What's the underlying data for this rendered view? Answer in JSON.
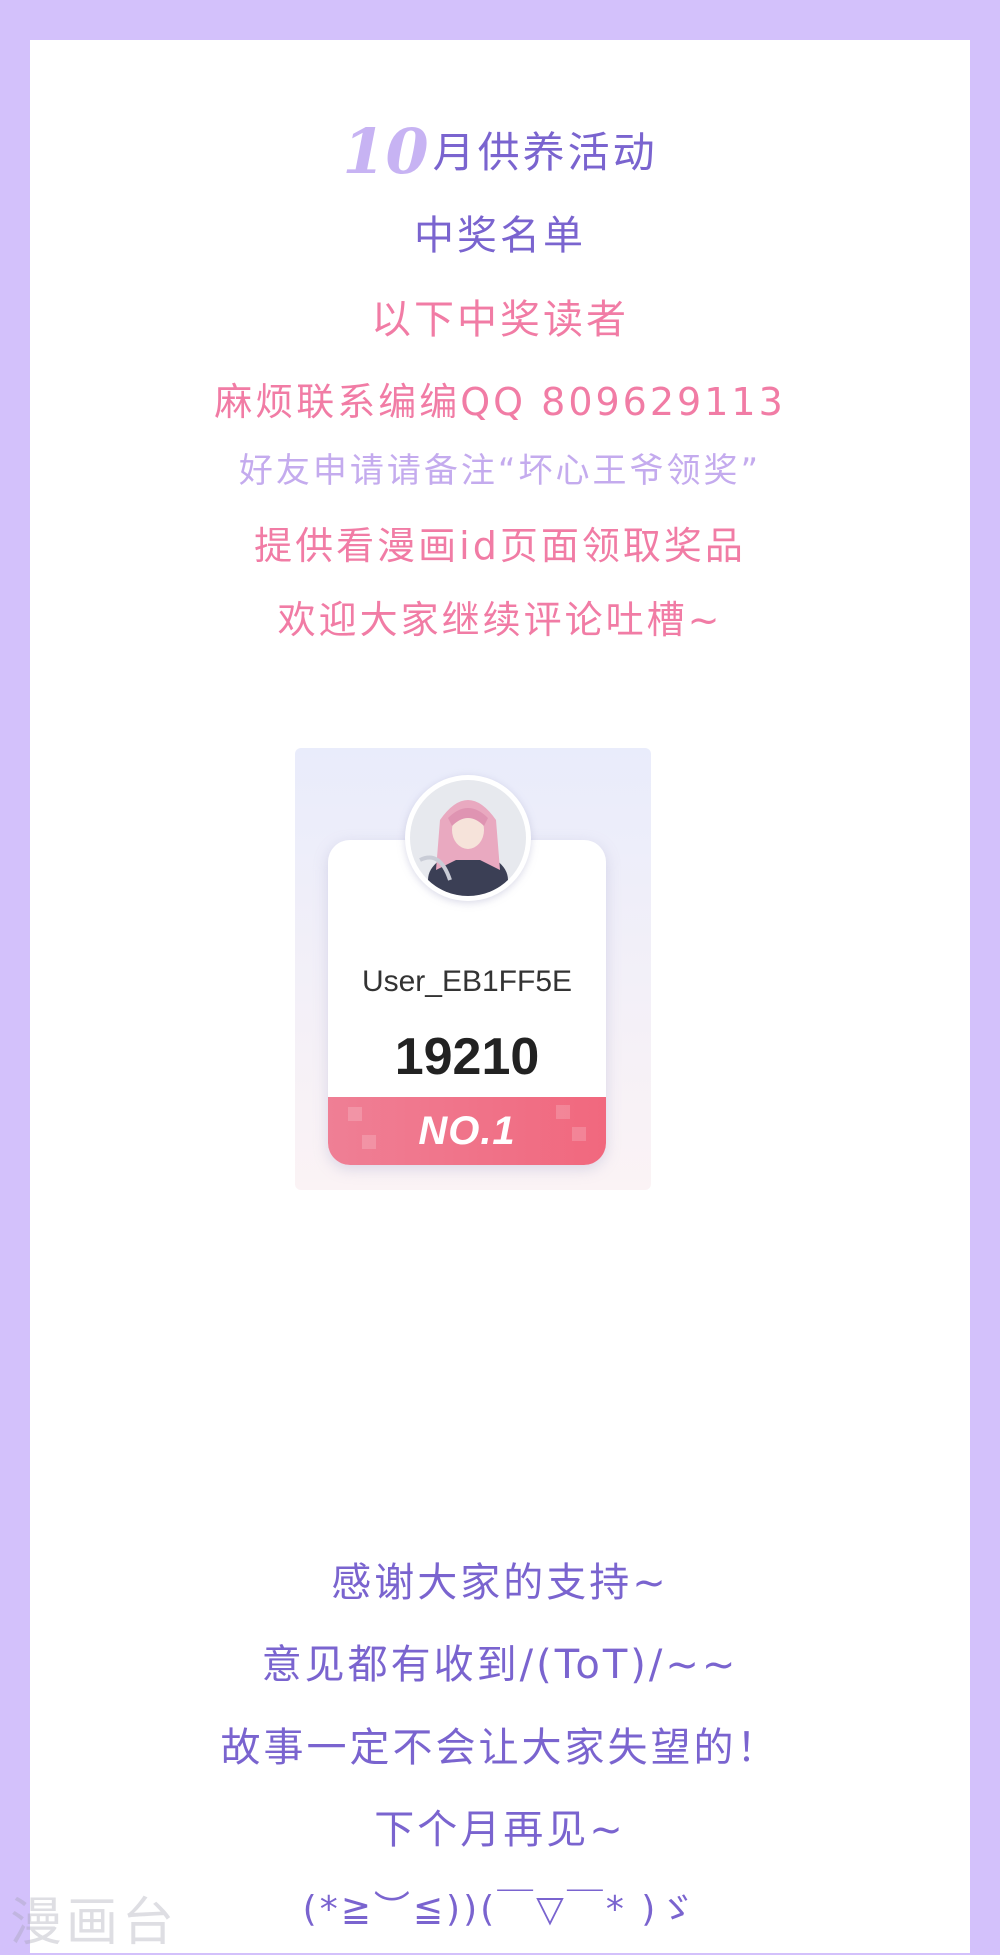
{
  "header": {
    "title_month": "10",
    "title_rest": "月供养活动",
    "subtitle": "中奖名单",
    "intro": "以下中奖读者",
    "contact": "麻烦联系编编QQ 809629113",
    "friend_note": "好友申请请备注“坏心王爷领奖”",
    "provide_note": "提供看漫画id页面领取奖品",
    "welcome": "欢迎大家继续评论吐槽~"
  },
  "winner": {
    "username": "User_EB1FF5E",
    "score": "19210",
    "rank": "NO.1",
    "avatar": "avatar-girl-pink-hair"
  },
  "footer": {
    "lines": [
      "感谢大家的支持~",
      "意见都有收到/(ToT)/~~",
      "故事一定不会让大家失望的！",
      "下个月再见~",
      "(*≧︶≦))(￣▽￣* )ゞ"
    ]
  },
  "watermark": "漫画台",
  "colors": {
    "background": "#d3c1fb",
    "purple_text": "#7a64cf",
    "pink_text": "#f17ca5",
    "lilac_text": "#c4abee",
    "rank_banner": "#f1687e"
  }
}
